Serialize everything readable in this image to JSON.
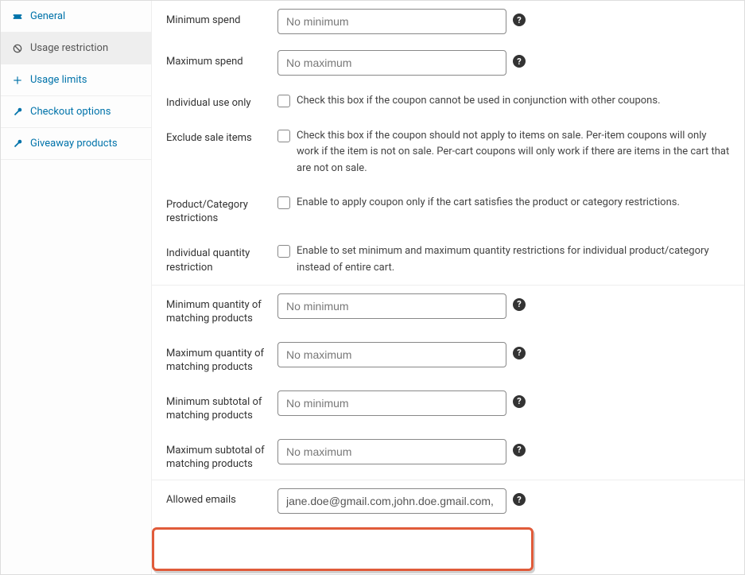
{
  "tabs": {
    "general": "General",
    "usage_restriction": "Usage restriction",
    "usage_limits": "Usage limits",
    "checkout_options": "Checkout options",
    "giveaway_products": "Giveaway products"
  },
  "labels": {
    "min_spend": "Minimum spend",
    "max_spend": "Maximum spend",
    "individual_use": "Individual use only",
    "exclude_sale": "Exclude sale items",
    "prod_cat_restrict": "Product/Category restrictions",
    "indiv_qty_restrict": "Individual quantity restriction",
    "min_qty": "Minimum quantity of matching products",
    "max_qty": "Maximum quantity of matching products",
    "min_subtotal": "Minimum subtotal of matching products",
    "max_subtotal": "Maximum subtotal of matching products",
    "allowed_emails": "Allowed emails"
  },
  "placeholders": {
    "no_minimum": "No minimum",
    "no_maximum": "No maximum"
  },
  "values": {
    "min_spend": "",
    "max_spend": "",
    "min_qty": "",
    "max_qty": "",
    "min_subtotal": "",
    "max_subtotal": "",
    "allowed_emails": "jane.doe@gmail.com,john.doe.gmail.com,"
  },
  "descriptions": {
    "individual_use": "Check this box if the coupon cannot be used in conjunction with other coupons.",
    "exclude_sale": "Check this box if the coupon should not apply to items on sale. Per-item coupons will only work if the item is not on sale. Per-cart coupons will only work if there are items in the cart that are not on sale.",
    "prod_cat_restrict": "Enable to apply coupon only if the cart satisfies the product or category restrictions.",
    "indiv_qty_restrict": "Enable to set minimum and maximum quantity restrictions for individual product/category instead of entire cart."
  },
  "help_char": "?"
}
